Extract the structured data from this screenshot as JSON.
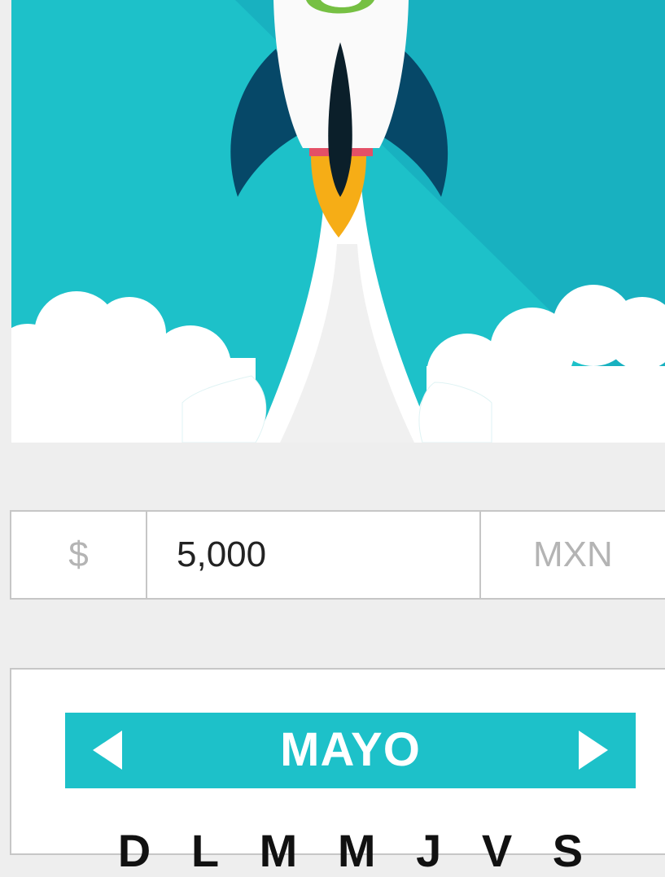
{
  "hero": {
    "colors": {
      "sky": "#1dc1c9",
      "sky_shadow": "#18b1c0",
      "rocket_body": "#fafafa",
      "fins": "#064868",
      "window": "#0b1f2a",
      "band": "#e35067",
      "flame": "#f6ad16",
      "logo": "#76c043",
      "clouds": "#ffffff"
    }
  },
  "amount": {
    "currency_symbol": "$",
    "value": "5,000",
    "currency_code": "MXN"
  },
  "calendar": {
    "month": "MAYO",
    "accent": "#1dc1c9",
    "weekdays": [
      "D",
      "L",
      "M",
      "M",
      "J",
      "V",
      "S"
    ]
  }
}
